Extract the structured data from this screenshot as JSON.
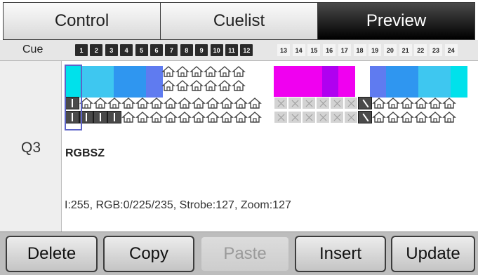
{
  "tabs": [
    {
      "label": "Control",
      "active": false
    },
    {
      "label": "Cuelist",
      "active": false
    },
    {
      "label": "Preview",
      "active": true
    }
  ],
  "cue_header": {
    "label": "Cue",
    "numbers": [
      "1",
      "2",
      "3",
      "4",
      "5",
      "6",
      "7",
      "8",
      "9",
      "10",
      "11",
      "12",
      "13",
      "14",
      "15",
      "16",
      "17",
      "18",
      "19",
      "20",
      "21",
      "22",
      "23",
      "24"
    ],
    "dark_count": 12
  },
  "cue": {
    "label": "Q3",
    "fixture_name": "RGBSZ",
    "status": "I:255, RGB:0/225/235, Strobe:127, Zoom:127"
  },
  "colors": {
    "cyan": "#00e1eb",
    "sky": "#3ec7f0",
    "blue": "#2f96f0",
    "periwinkle": "#5f7bf0",
    "magenta": "#f000f0",
    "violet": "#b000f0",
    "tab_active": "#000000"
  },
  "buttons": [
    {
      "label": "Delete",
      "enabled": true
    },
    {
      "label": "Copy",
      "enabled": true
    },
    {
      "label": "Paste",
      "enabled": false
    },
    {
      "label": "Insert",
      "enabled": true
    },
    {
      "label": "Update",
      "enabled": true
    }
  ]
}
